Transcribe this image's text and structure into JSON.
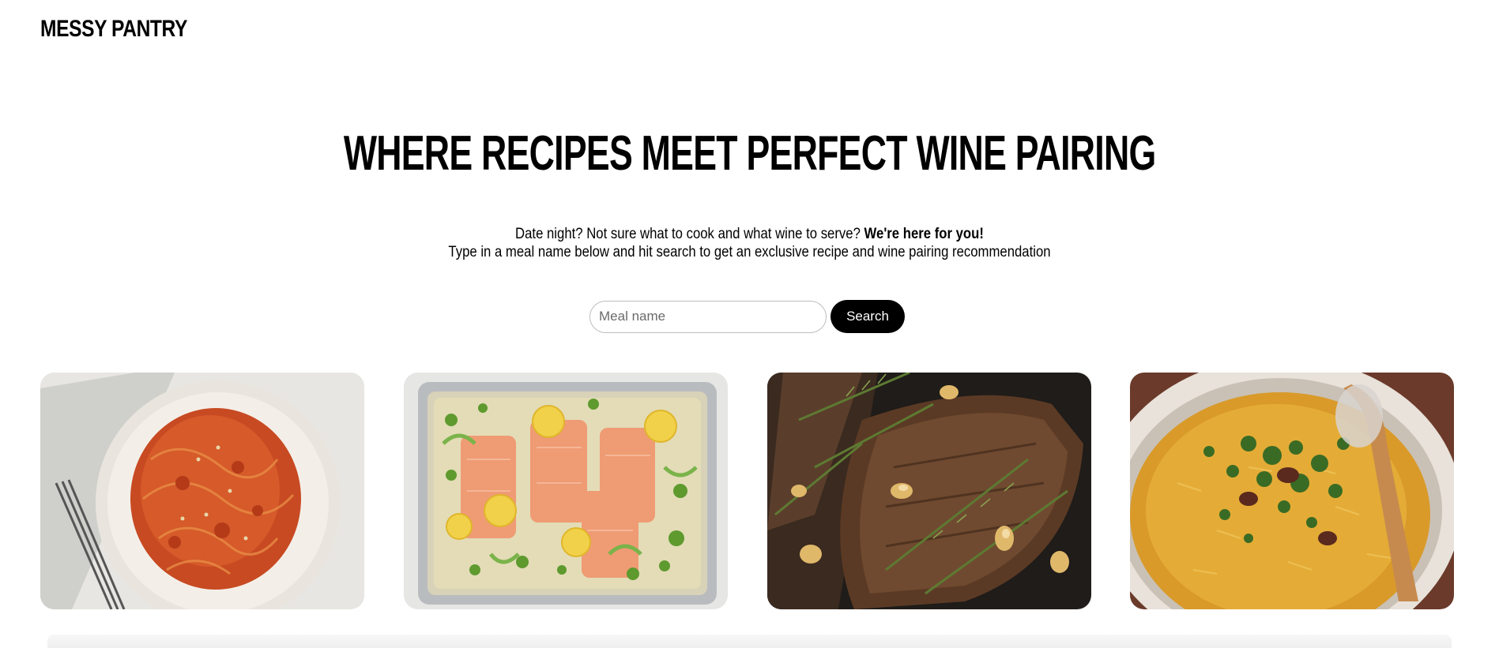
{
  "brand": {
    "logo": "MESSY PANTRY"
  },
  "hero": {
    "title": "WHERE RECIPES MEET PERFECT WINE PAIRING",
    "intro_line1_regular": "Date night? Not sure what to cook and what wine to serve? ",
    "intro_line1_bold": "We're here for you!",
    "intro_line2": "Type in a meal name below and hit search to get an exclusive recipe and wine pairing recommendation"
  },
  "search": {
    "placeholder": "Meal name",
    "value": "",
    "button_label": "Search"
  },
  "colors": {
    "button_bg": "#000000",
    "button_text": "#ffffff",
    "input_border": "#bdbdbd"
  }
}
